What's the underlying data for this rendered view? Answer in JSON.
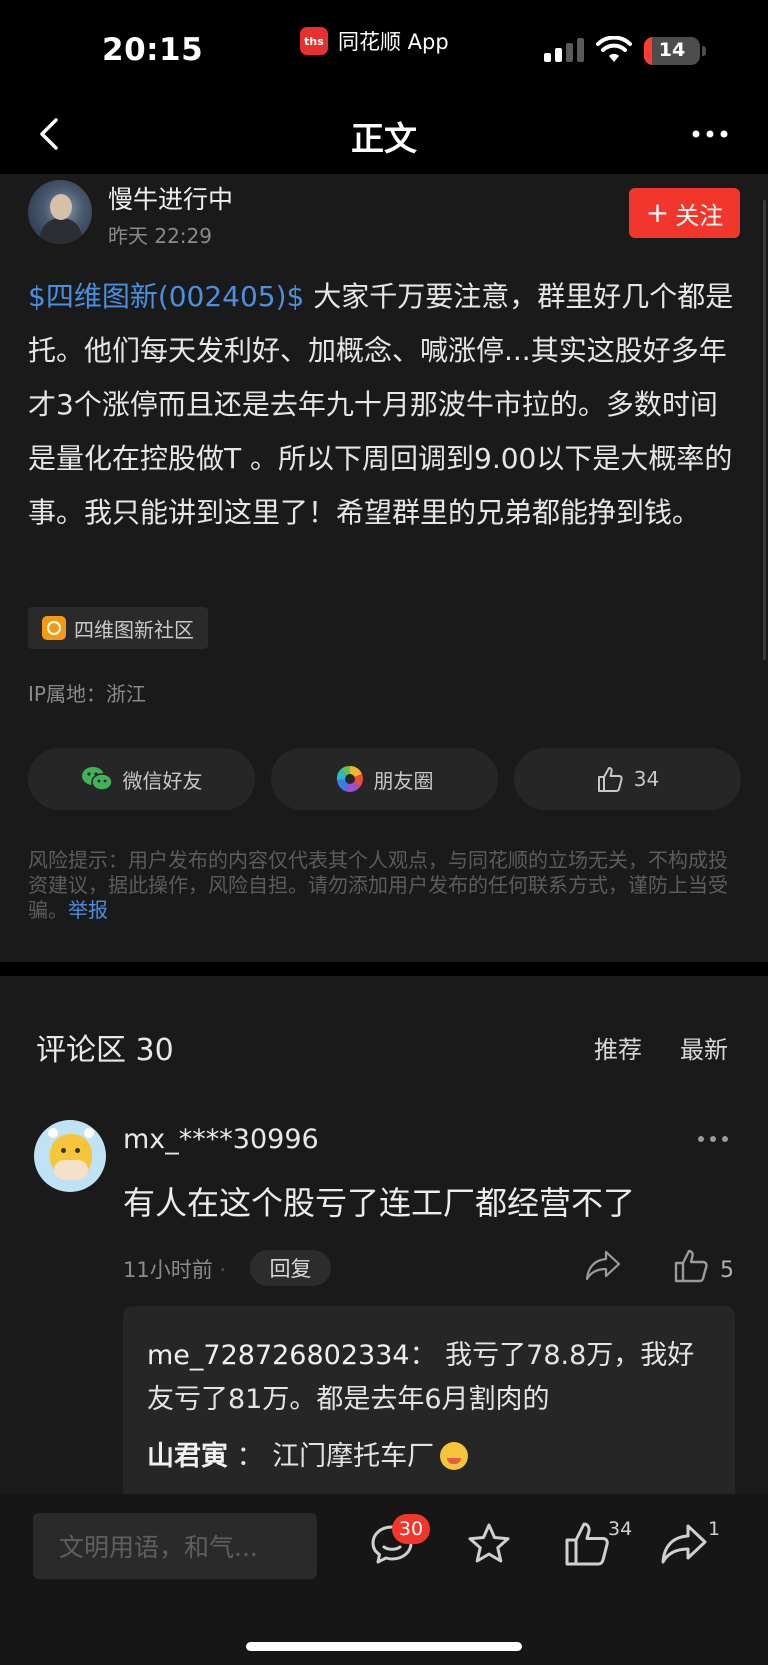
{
  "status_bar": {
    "time": "20:15",
    "app_name": "同花顺 App",
    "app_logo_text": "ths",
    "battery_level": "14",
    "signal_icon": "signal-bars-icon",
    "wifi_icon": "wifi-icon"
  },
  "nav": {
    "title": "正文",
    "back_icon": "back-chevron-icon",
    "more_icon": "more-dots-icon"
  },
  "post": {
    "author": "慢牛进行中",
    "time": "昨天 22:29",
    "follow_label": "关注",
    "follow_plus": "+",
    "stock_tag": "$四维图新(002405)$",
    "body": " 大家千万要注意，群里好几个都是托。他们每天发利好、加概念、喊涨停...其实这股好多年才3个涨停而且还是去年九十月那波牛市拉的。多数时间是量化在控股做T 。所以下周回调到9.00以下是大概率的事。我只能讲到这里了！希望群里的兄弟都能挣到钱。",
    "community": "四维图新社区",
    "ip": "IP属地：浙江",
    "share_wechat": "微信好友",
    "share_moments": "朋友圈",
    "like_count": "34",
    "disclaimer": "风险提示：用户发布的内容仅代表其个人观点，与同花顺的立场无关，不构成投资建议，据此操作，风险自担。请勿添加用户发布的任何联系方式，谨防上当受骗。",
    "report_label": "举报"
  },
  "comments": {
    "title": "评论区 30",
    "sort_recommended": "推荐",
    "sort_latest": "最新",
    "items": [
      {
        "user": "mx_****30996",
        "text": "有人在这个股亏了连工厂都经营不了",
        "time": "11小时前",
        "dot": "·",
        "reply_label": "回复",
        "like_count": "5",
        "replies": [
          {
            "user": "me_728726802334",
            "sep": "：",
            "text": "我亏了78.8万，我好友亏了81万。都是去年6月割肉的"
          },
          {
            "user": "山君寅",
            "sep": "：",
            "text": "江门摩托车厂"
          }
        ]
      }
    ]
  },
  "toolbar": {
    "input_placeholder": "文明用语，和气...",
    "comment_badge": "30",
    "like_count": "34",
    "share_count": "1"
  },
  "colors": {
    "accent_red": "#f2362b",
    "link_blue": "#4a8fe0",
    "background": "#1a1a1a"
  }
}
